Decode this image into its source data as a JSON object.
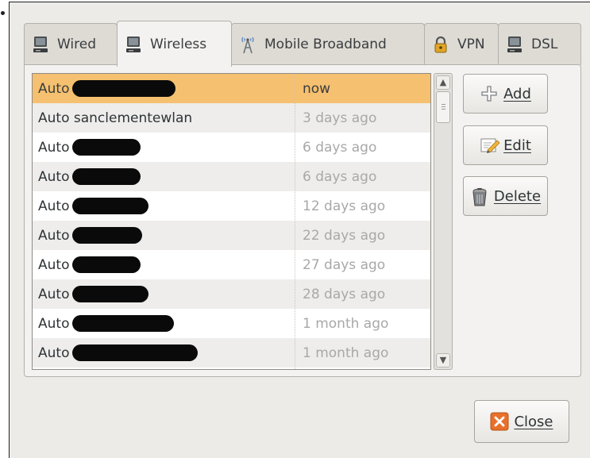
{
  "tabs": [
    {
      "label": "Wired",
      "icon": "wired-network-icon"
    },
    {
      "label": "Wireless",
      "icon": "wireless-network-icon"
    },
    {
      "label": "Mobile Broadband",
      "icon": "mobile-broadband-tower-icon"
    },
    {
      "label": "VPN",
      "icon": "vpn-lock-icon"
    },
    {
      "label": "DSL",
      "icon": "dsl-network-icon"
    }
  ],
  "active_tab": "Wireless",
  "connections": [
    {
      "name": "Auto",
      "last_used": "now",
      "selected": true
    },
    {
      "name": "Auto sanclementewlan",
      "last_used": "3 days ago"
    },
    {
      "name": "Auto",
      "last_used": "6 days ago"
    },
    {
      "name": "Auto",
      "last_used": "6 days ago"
    },
    {
      "name": "Auto",
      "last_used": "12 days ago"
    },
    {
      "name": "Auto",
      "last_used": "22 days ago"
    },
    {
      "name": "Auto",
      "last_used": "27 days ago"
    },
    {
      "name": "Auto",
      "last_used": "28 days ago"
    },
    {
      "name": "Auto",
      "last_used": "1 month ago"
    },
    {
      "name": "Auto",
      "last_used": "1 month ago"
    }
  ],
  "actions": {
    "add": "Add",
    "edit": "Edit",
    "delete": "Delete"
  },
  "close": "Close",
  "colors": {
    "selection": "#f5c06f",
    "window_bg": "#edebe7",
    "close_icon": "#e8702a"
  }
}
